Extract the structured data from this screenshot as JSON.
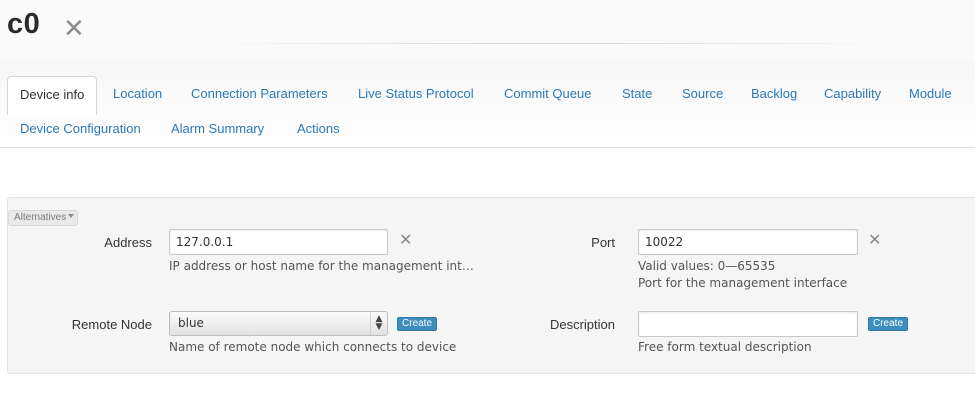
{
  "page": {
    "title": "c0",
    "close_glyph": "✕"
  },
  "tabs": [
    {
      "label": "Device info",
      "active": true
    },
    {
      "label": "Location"
    },
    {
      "label": "Connection Parameters"
    },
    {
      "label": "Live Status Protocol"
    },
    {
      "label": "Commit Queue"
    },
    {
      "label": "State"
    },
    {
      "label": "Source"
    },
    {
      "label": "Backlog"
    },
    {
      "label": "Capability"
    },
    {
      "label": "Module"
    },
    {
      "label": "Device Configuration"
    },
    {
      "label": "Alarm Summary"
    },
    {
      "label": "Actions"
    }
  ],
  "form": {
    "alternatives_label": "Alternatives",
    "address": {
      "label": "Address",
      "value": "127.0.0.1",
      "help": "IP address or host name for the management int…",
      "clear_glyph": "✕"
    },
    "port": {
      "label": "Port",
      "value": "10022",
      "valid_values": "Valid values: 0—65535",
      "help": "Port for the management interface",
      "clear_glyph": "✕"
    },
    "remote_node": {
      "label": "Remote Node",
      "selected": "blue",
      "arrows": "▲▼",
      "create_label": "Create",
      "help": "Name of remote node which connects to device"
    },
    "description": {
      "label": "Description",
      "value": "",
      "create_label": "Create",
      "help": "Free form textual description"
    }
  },
  "colors": {
    "link": "#2a7ab8",
    "create_button": "#3d8ebf",
    "panel_bg": "#f5f5f5"
  }
}
